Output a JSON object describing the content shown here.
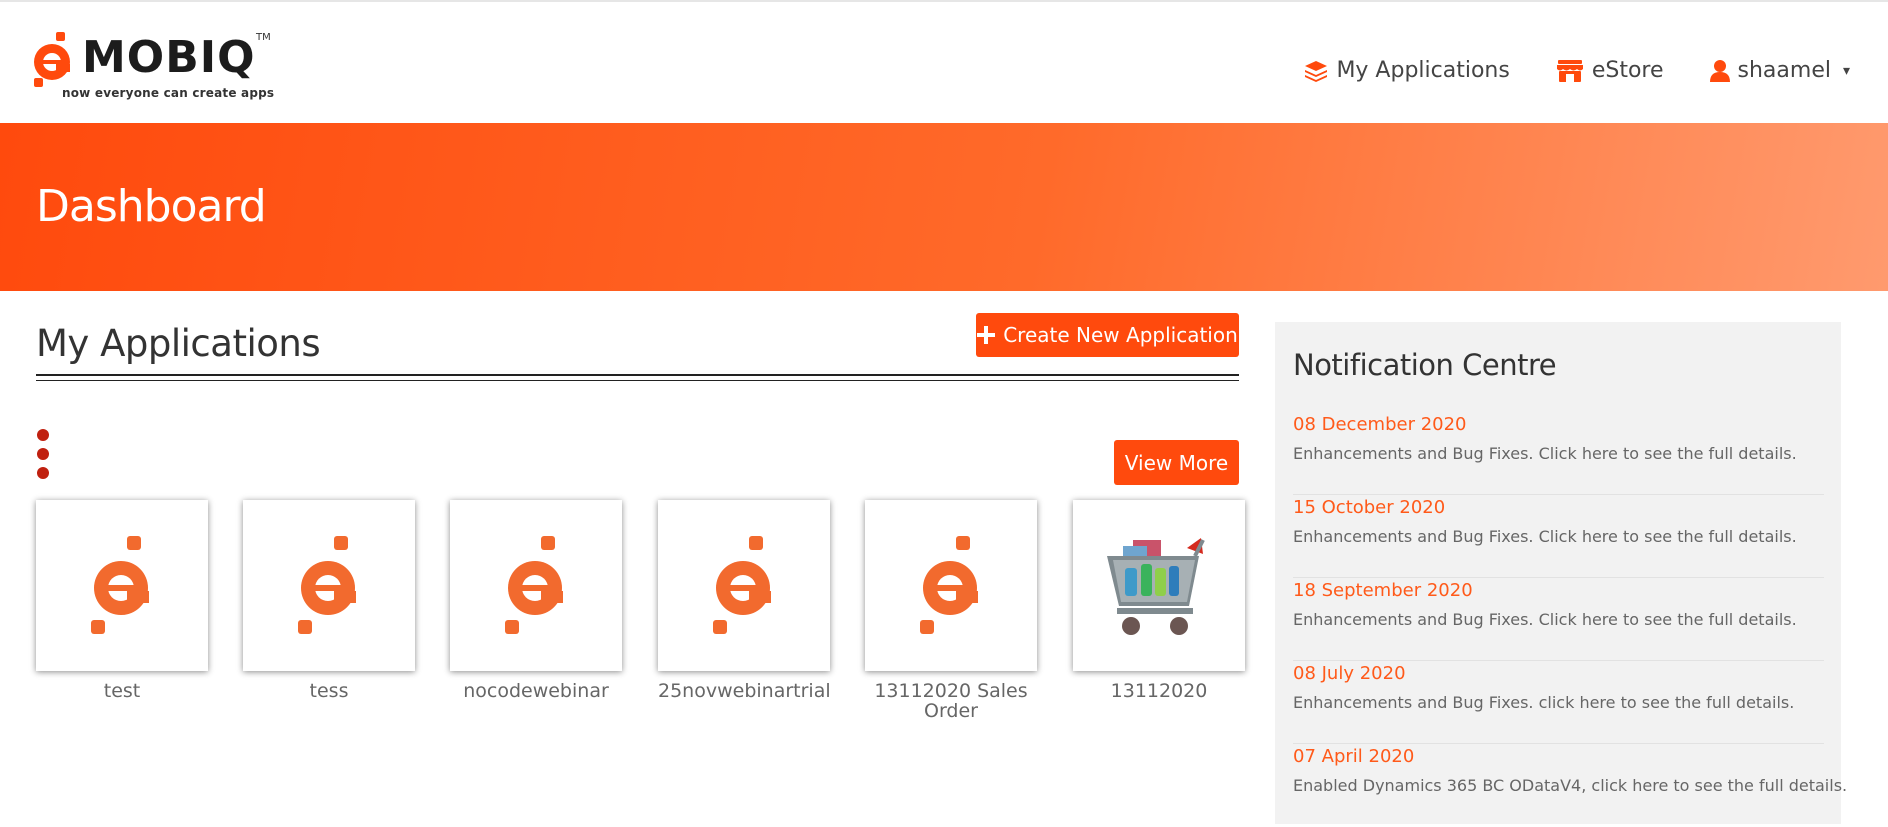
{
  "brand": {
    "name": "MOBIQ",
    "tm": "TM",
    "tagline": "now everyone can create apps",
    "accent": "#ff4a0d"
  },
  "nav": {
    "my_applications": "My Applications",
    "estore": "eStore",
    "user": "shaamel",
    "icons": [
      "layers-icon",
      "store-icon",
      "user-icon",
      "caret-down-icon"
    ]
  },
  "banner": {
    "title": "Dashboard"
  },
  "apps": {
    "title": "My Applications",
    "create_label": "Create New Application",
    "view_more_label": "View More",
    "items": [
      {
        "name": "test",
        "icon": "emobiq-logo-icon"
      },
      {
        "name": "tess",
        "icon": "emobiq-logo-icon"
      },
      {
        "name": "nocodewebinar",
        "icon": "emobiq-logo-icon"
      },
      {
        "name": "25novwebinartrial",
        "icon": "emobiq-logo-icon"
      },
      {
        "name": "13112020 Sales Order",
        "icon": "emobiq-logo-icon"
      },
      {
        "name": "13112020",
        "icon": "shopping-cart-icon"
      }
    ]
  },
  "notifications": {
    "title": "Notification Centre",
    "items": [
      {
        "date": "08 December 2020",
        "text": "Enhancements and Bug Fixes. Click here to see the full details."
      },
      {
        "date": "15 October 2020",
        "text": "Enhancements and Bug Fixes. Click here to see the full details."
      },
      {
        "date": "18 September 2020",
        "text": "Enhancements and Bug Fixes. Click here to see the full details."
      },
      {
        "date": "08 July 2020",
        "text": "Enhancements and Bug Fixes. click here to see the full details."
      },
      {
        "date": "07 April 2020",
        "text": "Enabled Dynamics 365 BC ODataV4, click here to see the full details."
      }
    ]
  }
}
